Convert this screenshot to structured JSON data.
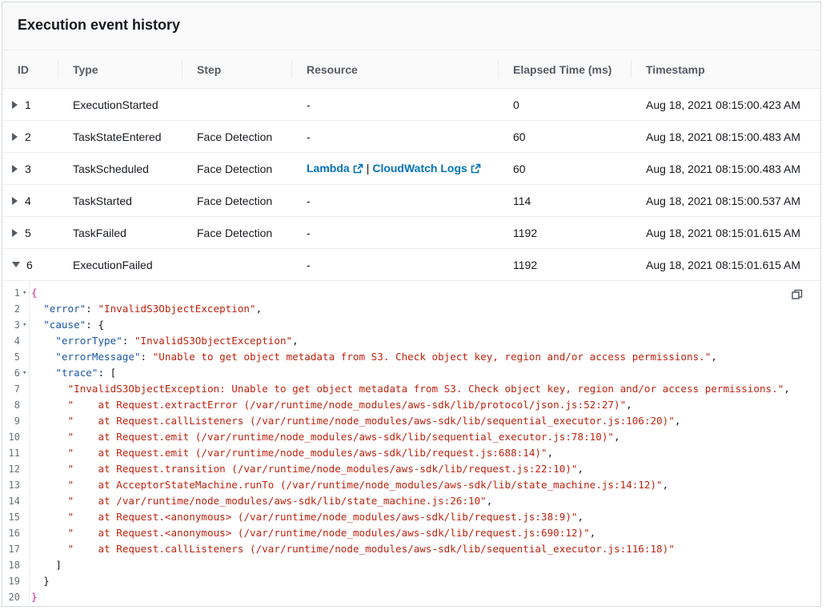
{
  "panel": {
    "title": "Execution event history"
  },
  "table": {
    "columns": [
      "ID",
      "Type",
      "Step",
      "Resource",
      "Elapsed Time (ms)",
      "Timestamp"
    ],
    "rows": [
      {
        "id": "1",
        "type": "ExecutionStarted",
        "step": "",
        "resource": "-",
        "elapsed": "0",
        "timestamp": "Aug 18, 2021 08:15:00.423 AM",
        "expanded": false
      },
      {
        "id": "2",
        "type": "TaskStateEntered",
        "step": "Face Detection",
        "resource": "-",
        "elapsed": "60",
        "timestamp": "Aug 18, 2021 08:15:00.483 AM",
        "expanded": false
      },
      {
        "id": "3",
        "type": "TaskScheduled",
        "step": "Face Detection",
        "resource_links": [
          "Lambda",
          "CloudWatch Logs"
        ],
        "resource_separator": "|",
        "elapsed": "60",
        "timestamp": "Aug 18, 2021 08:15:00.483 AM",
        "expanded": false
      },
      {
        "id": "4",
        "type": "TaskStarted",
        "step": "Face Detection",
        "resource": "-",
        "elapsed": "114",
        "timestamp": "Aug 18, 2021 08:15:00.537 AM",
        "expanded": false
      },
      {
        "id": "5",
        "type": "TaskFailed",
        "step": "Face Detection",
        "resource": "-",
        "elapsed": "1192",
        "timestamp": "Aug 18, 2021 08:15:01.615 AM",
        "expanded": false
      },
      {
        "id": "6",
        "type": "ExecutionFailed",
        "step": "",
        "resource": "-",
        "elapsed": "1192",
        "timestamp": "Aug 18, 2021 08:15:01.615 AM",
        "expanded": true
      }
    ]
  },
  "code": {
    "lines": [
      {
        "n": "1",
        "fold": true,
        "text": "{"
      },
      {
        "n": "2",
        "fold": false,
        "indent": 2,
        "key": "\"error\"",
        "value": "\"InvalidS3ObjectException\"",
        "tail": ","
      },
      {
        "n": "3",
        "fold": true,
        "indent": 2,
        "key": "\"cause\"",
        "open": "{"
      },
      {
        "n": "4",
        "fold": false,
        "indent": 4,
        "key": "\"errorType\"",
        "value": "\"InvalidS3ObjectException\"",
        "tail": ","
      },
      {
        "n": "5",
        "fold": false,
        "indent": 4,
        "key": "\"errorMessage\"",
        "value": "\"Unable to get object metadata from S3. Check object key, region and/or access permissions.\"",
        "tail": ","
      },
      {
        "n": "6",
        "fold": true,
        "indent": 4,
        "key": "\"trace\"",
        "open": "["
      },
      {
        "n": "7",
        "fold": false,
        "indent": 6,
        "value": "\"InvalidS3ObjectException: Unable to get object metadata from S3. Check object key, region and/or access permissions.\"",
        "tail": ","
      },
      {
        "n": "8",
        "fold": false,
        "indent": 6,
        "value": "\"    at Request.extractError (/var/runtime/node_modules/aws-sdk/lib/protocol/json.js:52:27)\"",
        "tail": ","
      },
      {
        "n": "9",
        "fold": false,
        "indent": 6,
        "value": "\"    at Request.callListeners (/var/runtime/node_modules/aws-sdk/lib/sequential_executor.js:106:20)\"",
        "tail": ","
      },
      {
        "n": "10",
        "fold": false,
        "indent": 6,
        "value": "\"    at Request.emit (/var/runtime/node_modules/aws-sdk/lib/sequential_executor.js:78:10)\"",
        "tail": ","
      },
      {
        "n": "11",
        "fold": false,
        "indent": 6,
        "value": "\"    at Request.emit (/var/runtime/node_modules/aws-sdk/lib/request.js:688:14)\"",
        "tail": ","
      },
      {
        "n": "12",
        "fold": false,
        "indent": 6,
        "value": "\"    at Request.transition (/var/runtime/node_modules/aws-sdk/lib/request.js:22:10)\"",
        "tail": ","
      },
      {
        "n": "13",
        "fold": false,
        "indent": 6,
        "value": "\"    at AcceptorStateMachine.runTo (/var/runtime/node_modules/aws-sdk/lib/state_machine.js:14:12)\"",
        "tail": ","
      },
      {
        "n": "14",
        "fold": false,
        "indent": 6,
        "value": "\"    at /var/runtime/node_modules/aws-sdk/lib/state_machine.js:26:10\"",
        "tail": ","
      },
      {
        "n": "15",
        "fold": false,
        "indent": 6,
        "value": "\"    at Request.<anonymous> (/var/runtime/node_modules/aws-sdk/lib/request.js:38:9)\"",
        "tail": ","
      },
      {
        "n": "16",
        "fold": false,
        "indent": 6,
        "value": "\"    at Request.<anonymous> (/var/runtime/node_modules/aws-sdk/lib/request.js:690:12)\"",
        "tail": ","
      },
      {
        "n": "17",
        "fold": false,
        "indent": 6,
        "value": "\"    at Request.callListeners (/var/runtime/node_modules/aws-sdk/lib/sequential_executor.js:116:18)\"",
        "tail": ""
      },
      {
        "n": "18",
        "fold": false,
        "indent": 4,
        "text": "]"
      },
      {
        "n": "19",
        "fold": false,
        "indent": 2,
        "text": "}"
      },
      {
        "n": "20",
        "fold": false,
        "text": "}"
      }
    ]
  },
  "icons": {
    "expand": "caret-right-icon",
    "collapse": "caret-down-icon",
    "external": "external-link-icon",
    "copy": "copy-icon"
  },
  "colors": {
    "link": "#0073bb",
    "json_key": "#1a56a8",
    "json_string": "#c1230f",
    "bracket": "#d6249f"
  }
}
